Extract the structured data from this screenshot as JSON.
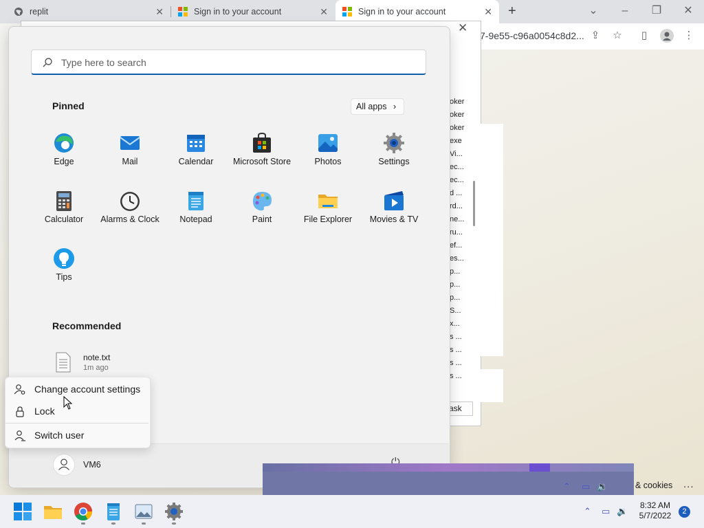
{
  "browser": {
    "tabs": [
      {
        "title": "replit"
      },
      {
        "title": "Sign in to your account"
      },
      {
        "title": "Sign in to your account"
      }
    ],
    "new_tab_symbol": "+",
    "url_fragment": "7-9e55-c96a0054c8d2..."
  },
  "background_window": {
    "process_items": [
      "oker",
      "oker",
      "oker",
      "exe",
      "Vi...",
      "ec...",
      "ec...",
      "d ...",
      "rd...",
      "ne...",
      "ru...",
      "ef...",
      "es...",
      "p...",
      "p...",
      "p...",
      "S...",
      "x...",
      "s ...",
      "s ...",
      "s ...",
      "s ..."
    ],
    "button_label": "ask"
  },
  "start_menu": {
    "search_placeholder": "Type here to search",
    "pinned_title": "Pinned",
    "all_apps_label": "All apps",
    "pinned_apps": [
      {
        "label": "Edge",
        "icon": "edge-icon"
      },
      {
        "label": "Mail",
        "icon": "mail-icon"
      },
      {
        "label": "Calendar",
        "icon": "calendar-icon"
      },
      {
        "label": "Microsoft Store",
        "icon": "store-icon"
      },
      {
        "label": "Photos",
        "icon": "photos-icon"
      },
      {
        "label": "Settings",
        "icon": "settings-icon"
      },
      {
        "label": "Calculator",
        "icon": "calculator-icon"
      },
      {
        "label": "Alarms & Clock",
        "icon": "clock-icon"
      },
      {
        "label": "Notepad",
        "icon": "notepad-icon"
      },
      {
        "label": "Paint",
        "icon": "paint-icon"
      },
      {
        "label": "File Explorer",
        "icon": "folder-icon"
      },
      {
        "label": "Movies & TV",
        "icon": "movies-icon"
      },
      {
        "label": "Tips",
        "icon": "tips-icon"
      }
    ],
    "recommended_title": "Recommended",
    "recommended": [
      {
        "name": "note.txt",
        "time": "1m ago"
      }
    ],
    "user_name": "VM6"
  },
  "account_menu": {
    "items": [
      {
        "label": "Change account settings",
        "icon": "account-settings-icon"
      },
      {
        "label": "Lock",
        "icon": "lock-icon"
      },
      {
        "label": "Switch user",
        "icon": "switch-user-icon"
      }
    ]
  },
  "taskbar": {
    "apps": [
      "start-icon",
      "file-explorer-icon",
      "chrome-icon",
      "notepad-icon",
      "photos-icon",
      "settings-icon"
    ],
    "cookies_text": "& cookies",
    "more_text": "...",
    "time": "8:32 AM",
    "date": "5/7/2022",
    "notification_count": "2"
  },
  "colors": {
    "accent": "#0f5ea8",
    "taskbar": "#eef0f5",
    "start_menu": "#f2f2f2",
    "overlay_window": "#7077a7"
  }
}
